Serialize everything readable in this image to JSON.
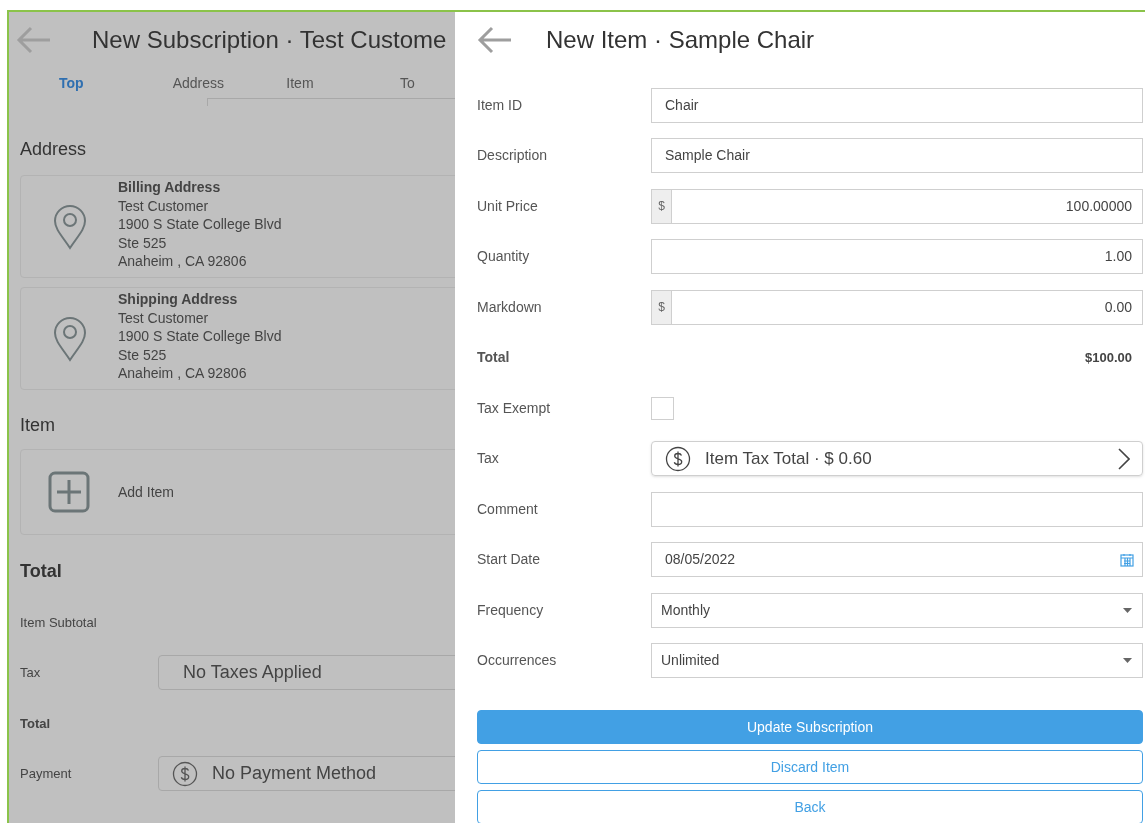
{
  "back_panel": {
    "title": "New Subscription · Test Custome",
    "tabs": [
      {
        "label": "Top",
        "selected": true
      },
      {
        "label": "Address",
        "selected": false
      },
      {
        "label": "Item",
        "selected": false
      },
      {
        "label": "To",
        "selected": false
      }
    ],
    "address_heading": "Address",
    "addresses": [
      {
        "title": "Billing Address",
        "lines": [
          "Test Customer",
          "1900 S State College Blvd",
          "Ste 525",
          "Anaheim , CA 92806"
        ]
      },
      {
        "title": "Shipping Address",
        "lines": [
          "Test Customer",
          "1900 S State College Blvd",
          "Ste 525",
          "Anaheim , CA 92806"
        ]
      }
    ],
    "item_heading": "Item",
    "add_item": "Add Item",
    "total_heading": "Total",
    "total_rows": [
      {
        "kind": "plain",
        "label": "Item Subtotal"
      },
      {
        "kind": "picker",
        "label": "Tax",
        "value": "No Taxes Applied"
      },
      {
        "kind": "bold",
        "label": "Total"
      },
      {
        "kind": "payment",
        "label": "Payment",
        "value": "No Payment Method"
      }
    ]
  },
  "item_panel": {
    "title": "New Item · Sample Chair",
    "fields": [
      {
        "kind": "text",
        "label": "Item ID",
        "value": "Chair"
      },
      {
        "kind": "text",
        "label": "Description",
        "value": "Sample Chair"
      },
      {
        "kind": "currency",
        "label": "Unit Price",
        "prefix": "$",
        "value": "100.00000"
      },
      {
        "kind": "number",
        "label": "Quantity",
        "value": "1.00"
      },
      {
        "kind": "currency",
        "label": "Markdown",
        "prefix": "$",
        "value": "0.00"
      },
      {
        "kind": "total",
        "label": "Total",
        "value": "$100.00"
      },
      {
        "kind": "checkbox",
        "label": "Tax Exempt",
        "checked": false
      },
      {
        "kind": "link",
        "label": "Tax",
        "value": "Item Tax Total · $ 0.60"
      },
      {
        "kind": "text",
        "label": "Comment"
      },
      {
        "kind": "date",
        "label": "Start Date",
        "value": "08/05/2022"
      },
      {
        "kind": "select",
        "label": "Frequency",
        "value": "Monthly"
      },
      {
        "kind": "select",
        "label": "Occurrences",
        "value": "Unlimited"
      }
    ],
    "buttons": [
      {
        "kind": "primary",
        "label": "Update Subscription"
      },
      {
        "kind": "outline",
        "label": "Discard Item"
      },
      {
        "kind": "outline",
        "label": "Back"
      }
    ]
  }
}
